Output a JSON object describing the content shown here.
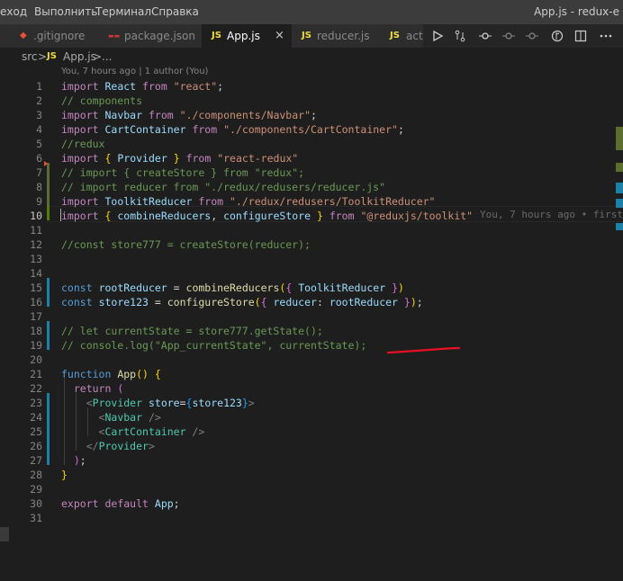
{
  "menu": {
    "items": [
      "еход",
      "Выполнить",
      "Терминал",
      "Справка"
    ],
    "title": "App.js - redux-e"
  },
  "tabs": [
    {
      "label": ".gitignore",
      "icon": "git-icon"
    },
    {
      "label": "package.json",
      "icon": "npm-icon"
    },
    {
      "label": "App.js",
      "icon": "js-icon",
      "active": true
    },
    {
      "label": "reducer.js",
      "icon": "js-icon"
    },
    {
      "label": "actio",
      "icon": "js-icon"
    }
  ],
  "js_badge": "JS",
  "close_glyph": "×",
  "breadcrumb": {
    "folder": "src",
    "sep1": ">",
    "file": "App.js",
    "sep2": ">",
    "more": "..."
  },
  "codelens": "You, 7 hours ago | 1 author (You)",
  "inline_blame": "You, 7 hours ago • first",
  "line_numbers": [
    "1",
    "2",
    "3",
    "4",
    "5",
    "6",
    "7",
    "8",
    "9",
    "10",
    "11",
    "12",
    "13",
    "14",
    "15",
    "16",
    "17",
    "18",
    "19",
    "20",
    "21",
    "22",
    "23",
    "24",
    "25",
    "26",
    "27",
    "28",
    "29",
    "30",
    "31"
  ],
  "code": {
    "l1": [
      "import",
      " ",
      "React",
      " ",
      "from",
      " ",
      "\"react\"",
      ";"
    ],
    "l2": [
      "// components"
    ],
    "l3": [
      "import",
      " ",
      "Navbar",
      " ",
      "from",
      " ",
      "\"./components/Navbar\"",
      ";"
    ],
    "l4": [
      "import",
      " ",
      "CartContainer",
      " ",
      "from",
      " ",
      "\"./components/CartContainer\"",
      ";"
    ],
    "l5": [
      "//redux"
    ],
    "l6": [
      "import",
      " ",
      "{",
      " ",
      "Provider",
      " ",
      "}",
      " ",
      "from",
      " ",
      "\"react-redux\""
    ],
    "l7": [
      "// import { createStore } from \"redux\";"
    ],
    "l8": [
      "// import reducer from \"./redux/redusers/reducer.js\""
    ],
    "l9": [
      "import",
      " ",
      "ToolkitReducer",
      " ",
      "from",
      " ",
      "\"./redux/redusers/ToolkitReducer\""
    ],
    "l10": [
      "import",
      " ",
      "{",
      " ",
      "combineReducers",
      ", ",
      "configureStore",
      " ",
      "}",
      " ",
      "from",
      " ",
      "\"@reduxjs/toolkit\""
    ],
    "l12": [
      "//const store777 = createStore(reducer);"
    ],
    "l15": [
      "const",
      " ",
      "rootReducer",
      " = ",
      "combineReducers",
      "(",
      "{",
      " ",
      "ToolkitReducer",
      " ",
      "}",
      ")"
    ],
    "l16": [
      "const",
      " ",
      "store123",
      " = ",
      "configureStore",
      "(",
      "{",
      " ",
      "reducer",
      ": ",
      "rootReducer",
      " ",
      "}",
      ")",
      ";"
    ],
    "l18": [
      "// let currentState = store777.getState();"
    ],
    "l19": [
      "// console.log(\"App_currentState\", currentState);"
    ],
    "l21": [
      "function",
      " ",
      "App",
      "()",
      " ",
      "{"
    ],
    "l22": [
      "  ",
      "return",
      " ",
      "("
    ],
    "l23": [
      "    ",
      "<",
      "Provider",
      " ",
      "store",
      "=",
      "{",
      "store123",
      "}",
      ">"
    ],
    "l24": [
      "      ",
      "<",
      "Navbar",
      " />"
    ],
    "l25": [
      "      ",
      "<",
      "CartContainer",
      " />"
    ],
    "l26": [
      "    ",
      "</",
      "Provider",
      ">"
    ],
    "l27": [
      "  ",
      ")",
      ";"
    ],
    "l28": [
      "}"
    ],
    "l30": [
      "export",
      " ",
      "default",
      " ",
      "App",
      ";"
    ]
  },
  "colors": {
    "background": "#1e1e1e",
    "keyword_control": "#c586c0",
    "keyword": "#569cd6",
    "variable": "#9cdcfe",
    "function": "#dcdcaa",
    "string": "#ce9178",
    "comment": "#6a9955",
    "component": "#4ec9b0",
    "annotation": "#e81123"
  }
}
